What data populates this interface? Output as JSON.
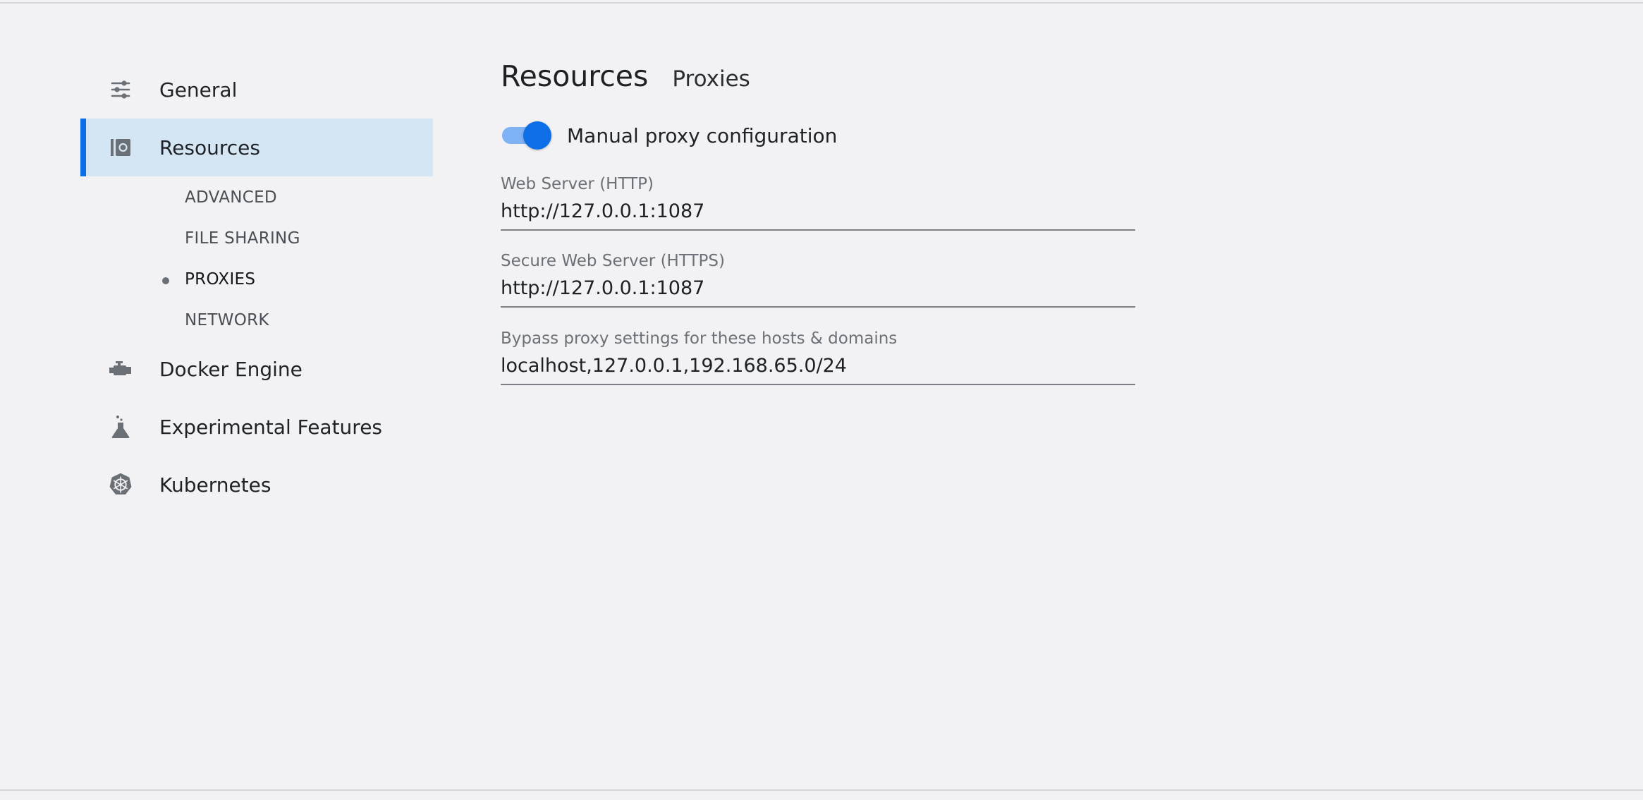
{
  "sidebar": {
    "items": [
      {
        "label": "General",
        "icon": "sliders-icon"
      },
      {
        "label": "Resources",
        "icon": "resources-icon",
        "active": true
      },
      {
        "label": "Docker Engine",
        "icon": "engine-icon"
      },
      {
        "label": "Experimental Features",
        "icon": "flask-icon"
      },
      {
        "label": "Kubernetes",
        "icon": "kubernetes-icon"
      }
    ],
    "sub_items": [
      {
        "label": "ADVANCED"
      },
      {
        "label": "FILE SHARING"
      },
      {
        "label": "PROXIES",
        "current": true
      },
      {
        "label": "NETWORK"
      }
    ]
  },
  "main": {
    "title": "Resources",
    "subtitle": "Proxies",
    "toggle": {
      "label": "Manual proxy configuration",
      "checked": true
    },
    "fields": [
      {
        "label": "Web Server (HTTP)",
        "value": "http://127.0.0.1:1087"
      },
      {
        "label": "Secure Web Server (HTTPS)",
        "value": "http://127.0.0.1:1087"
      },
      {
        "label": "Bypass proxy settings for these hosts & domains",
        "value": "localhost,127.0.0.1,192.168.65.0/24"
      }
    ]
  },
  "colors": {
    "accent": "#0d6ee8",
    "active_bg": "#d4e6f3",
    "background": "#f2f2f4"
  }
}
